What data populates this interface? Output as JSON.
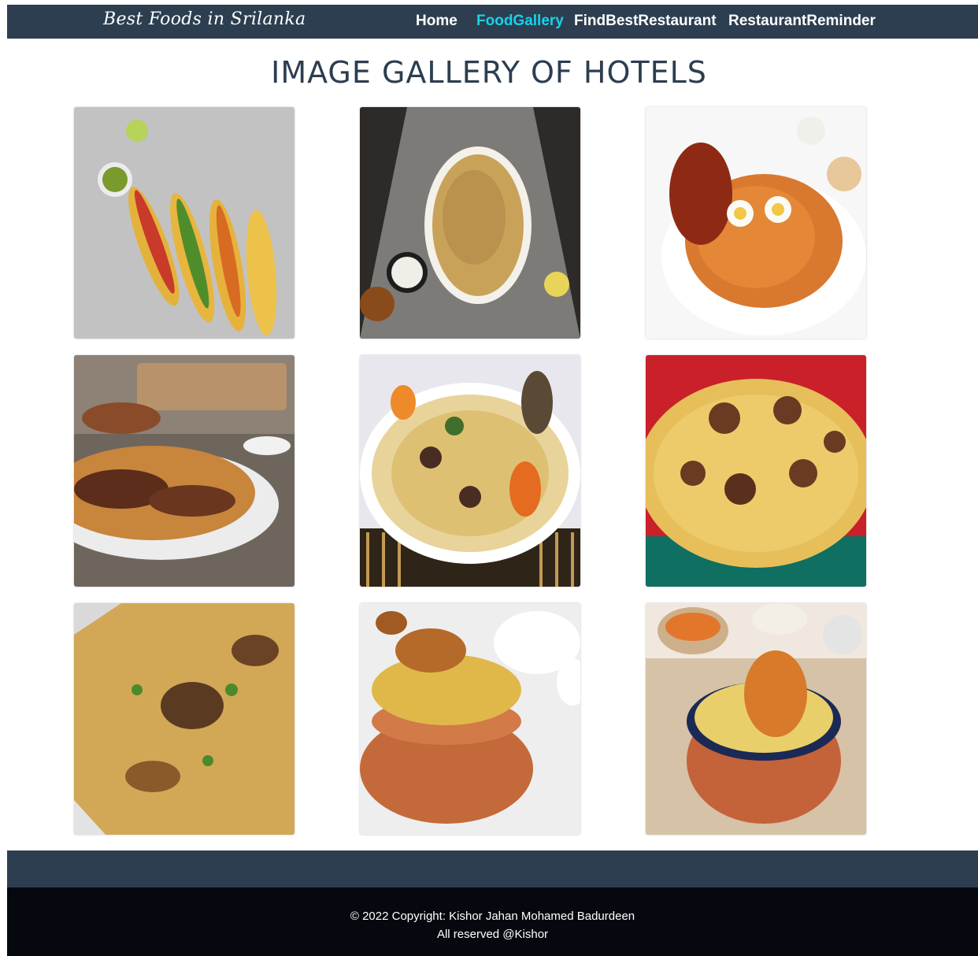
{
  "brand": "Best Foods in Srilanka",
  "nav": {
    "home": "Home",
    "food_gallery": "FoodGallery",
    "find_best_restaurant": "FindBestRestaurant",
    "restaurant_reminder": "RestaurantReminder",
    "active": "FoodGallery",
    "active_color": "#17d2e8"
  },
  "page_title": "IMAGE GALLERY OF HOTELS",
  "gallery": [
    {
      "subject": "tacos-photo"
    },
    {
      "subject": "biryani-plate-photo"
    },
    {
      "subject": "chicken-biryani-egg-photo"
    },
    {
      "subject": "mutton-biryani-photo"
    },
    {
      "subject": "biryani-bowl-photo"
    },
    {
      "subject": "beef-biryani-photo"
    },
    {
      "subject": "biryani-closeup-photo"
    },
    {
      "subject": "clay-pot-biryani-photo"
    },
    {
      "subject": "handi-biryani-photo"
    }
  ],
  "footer": {
    "copyright": "© 2022 Copyright: Kishor Jahan Mohamed Badurdeen",
    "rights": "All reserved @Kishor"
  },
  "colors": {
    "navbar": "#2c3e50",
    "footer_top": "#2c3e50",
    "footer_bottom": "#05090f"
  }
}
